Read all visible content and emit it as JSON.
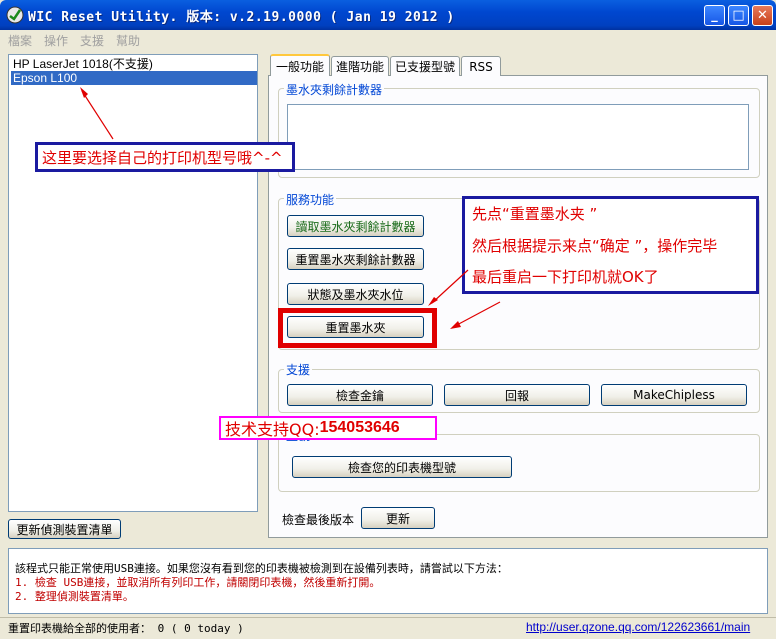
{
  "window": {
    "title": "WIC Reset Utility. 版本: v.2.19.0000 ( Jan 19 2012 )",
    "minimize_glyph": "_",
    "maximize_glyph": "□",
    "close_glyph": "✕"
  },
  "menu": [
    "檔案",
    "操作",
    "支援",
    "幫助"
  ],
  "devices": [
    {
      "label": "HP LaserJet 1018(不支援)",
      "selected": false
    },
    {
      "label": "Epson L100",
      "selected": true
    }
  ],
  "refresh_button": "更新偵測裝置清單",
  "tabs": [
    "一般功能",
    "進階功能",
    "已支援型號",
    "RSS"
  ],
  "ink_counter_group": "墨水夾剩餘計數器",
  "service_group": {
    "label": "服務功能",
    "read_button": "讀取墨水夾剩餘計數器",
    "reset_counter_button": "重置墨水夾剩餘計數器",
    "status_button": "狀態及墨水夾水位",
    "reset_cartridge_button": "重置墨水夾"
  },
  "support_group": {
    "label": "支援",
    "check_key_button": "檢查金鑰",
    "report_button": "回報",
    "makechipless_button": "MakeChipless"
  },
  "model_group": {
    "label": "型號",
    "check_model_button": "檢查您的印表機型號"
  },
  "update": {
    "label": "檢查最後版本",
    "button": "更新"
  },
  "annotations": {
    "left_note": "这里要选择自己的打印机型号哦^-^",
    "right_note_line1": "先点“重置墨水夹 ”",
    "right_note_line2": "然后根据提示来点“确定 ”，操作完毕",
    "right_note_line3": "最后重启一下打印机就OK了",
    "qq_prefix": "技术支持QQ:",
    "qq_number": "154053646"
  },
  "log": [
    "該程式只能正常使用USB連接。如果您沒有看到您的印表機被檢測到在設備列表時，請嘗試以下方法：",
    "1. 檢查 USB連接，並取消所有列印工作，請關閉印表機，然後重新打開。",
    "2. 整理偵測裝置清單。"
  ],
  "status": {
    "usage": "重置印表機給全部的使用者： 0 ( 0 today )",
    "link": "http://user.qzone.qq.com/122623661/main"
  },
  "colors": {
    "annotation_blue": "#1a1aa0",
    "annotation_red": "#e00000",
    "annotation_magenta": "#ff00ff",
    "selection": "#316ac5"
  }
}
